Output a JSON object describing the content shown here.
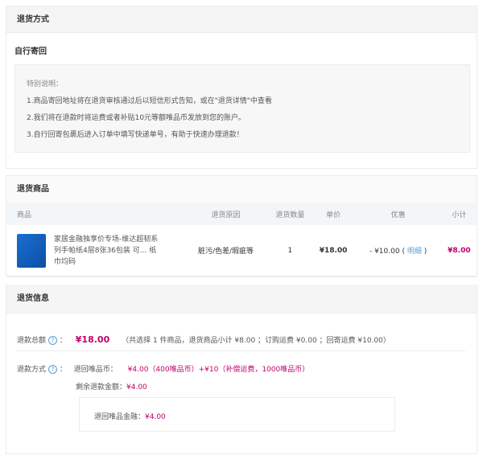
{
  "return_method": {
    "title": "退货方式",
    "subtitle": "自行寄回",
    "note_title": "特别说明：",
    "notes": [
      "1.商品寄回地址将在退货审核通过后以短信形式告知，或在\"退货详情\"中查看",
      "2.我们将在退款时将运费或者补贴10元等额唯品币发放到您的账户。",
      "3.自行回寄包裹后进入订单中填写快递单号，有助于快速办理退款！"
    ]
  },
  "return_goods": {
    "title": "退货商品",
    "headers": [
      "商品",
      "退货原因",
      "退货数量",
      "单价",
      "优惠",
      "小计"
    ],
    "items": [
      {
        "name": "家居金融独享价专场-维达超韧系列手帕纸4层8张36包装 可... 纸巾均码",
        "reason": "脏污/色差/瑕疵等",
        "qty": "1",
        "price": "¥18.00",
        "discount": "- ¥10.00",
        "detail_link": "明细",
        "subtotal": "¥8.00"
      }
    ]
  },
  "return_info": {
    "title": "退货信息",
    "total_label": "退款总额",
    "total_value": "¥18.00",
    "total_desc": "（共选择 1 件商品，退货商品小计 ¥8.00 ；订购运费 ¥0.00 ；回寄运费 ¥10.00）",
    "method_label": "退款方式",
    "colon": "：",
    "coin_label": "退回唯品币：",
    "coin_value": "¥4.00（400唯品币）+¥10（补偿运费，1000唯品币）",
    "remain_label": "剩余退款金额：",
    "remain_value": "¥4.00",
    "finance_label": "退回唯品金融：",
    "finance_value": "¥4.00",
    "help_icon": "?"
  },
  "colors": {
    "accent": "#c0006a",
    "link": "#5a9ed6"
  }
}
